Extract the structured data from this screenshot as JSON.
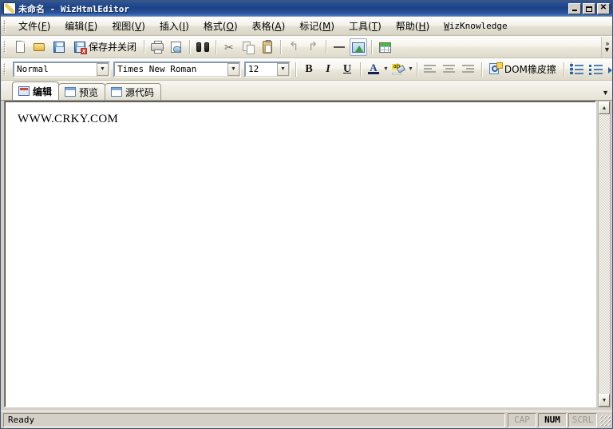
{
  "window": {
    "title": "未命名 - WizHtmlEditor",
    "icon": "editor-app-icon",
    "controls": {
      "minimize": "_",
      "maximize": "□",
      "close": "✕"
    }
  },
  "menubar": {
    "items": [
      {
        "label": "文件",
        "accel": "F"
      },
      {
        "label": "编辑",
        "accel": "E"
      },
      {
        "label": "视图",
        "accel": "V"
      },
      {
        "label": "插入",
        "accel": "I"
      },
      {
        "label": "格式",
        "accel": "O"
      },
      {
        "label": "表格",
        "accel": "A"
      },
      {
        "label": "标记",
        "accel": "M"
      },
      {
        "label": "工具",
        "accel": "T"
      },
      {
        "label": "帮助",
        "accel": "H"
      }
    ],
    "wiz_label_accel": "W",
    "wiz_label_rest": "izKnowledge"
  },
  "toolbar_main": {
    "new": "new-document",
    "open": "open-document",
    "save": "save-document",
    "save_close_icon": "save-and-close",
    "save_close_label": "保存并关闭",
    "print": "print",
    "print_preview": "print-preview",
    "find": "find",
    "cut": "cut",
    "copy": "copy",
    "paste": "paste",
    "undo": "undo",
    "redo": "redo",
    "hrule": "horizontal-rule",
    "insert_image": "insert-image",
    "insert_table": "insert-table",
    "overflow": "»"
  },
  "toolbar_format": {
    "style": {
      "value": "Normal"
    },
    "font": {
      "value": "Times New Roman"
    },
    "size": {
      "value": "12"
    },
    "bold": "B",
    "italic": "I",
    "underline": "U",
    "font_color": "A",
    "highlight": "ab",
    "align_left": "align-left",
    "align_center": "align-center",
    "align_right": "align-right",
    "dom_eraser_label": "DOM橡皮擦",
    "numbered_list": "numbered-list",
    "bulleted_list": "bulleted-list",
    "indent": "indent",
    "overflow": "»",
    "dom_tree": "dom-tree"
  },
  "tabs": [
    {
      "label": "编辑",
      "active": true,
      "icon": "edit-doc-icon"
    },
    {
      "label": "预览",
      "active": false,
      "icon": "preview-window-icon"
    },
    {
      "label": "源代码",
      "active": false,
      "icon": "source-window-icon"
    }
  ],
  "editor": {
    "content": "WWW.CRKY.COM"
  },
  "statusbar": {
    "message": "Ready",
    "indicators": [
      {
        "label": "CAP",
        "active": false
      },
      {
        "label": "NUM",
        "active": true
      },
      {
        "label": "SCRL",
        "active": false
      }
    ]
  },
  "colors": {
    "title_gradient_start": "#2f5a9e",
    "title_gradient_end": "#1d4286",
    "chrome": "#d4d0c8",
    "editor_background": "#ffffff",
    "accent_blue": "#2f63a8"
  }
}
